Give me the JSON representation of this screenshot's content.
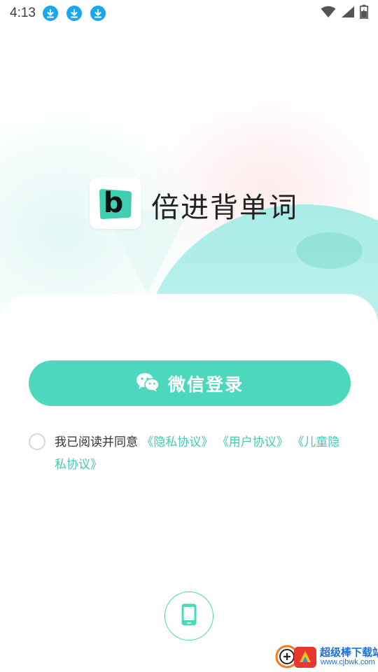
{
  "status_bar": {
    "time": "4:13",
    "notification_icons": [
      "download-icon",
      "download-icon",
      "download-icon"
    ],
    "right_icons": [
      "wifi-icon",
      "signal-icon",
      "battery-icon"
    ]
  },
  "app": {
    "logo_letter": "b",
    "name": "倍进背单词"
  },
  "login": {
    "wechat_button_label": "微信登录",
    "agreement_prefix": "我已阅读并同意",
    "privacy_link": "《隐私协议》",
    "user_link": "《用户协议》",
    "child_privacy_link": "《儿童隐私协议》"
  },
  "alt_login": {
    "phone_icon": "phone-icon"
  },
  "watermark": {
    "line1": "超级棒下载站",
    "line2": "www.cjbwk.com"
  },
  "colors": {
    "accent": "#4cd8bd",
    "link": "#41cbb3",
    "logo_green": "#3fcfb0",
    "download_blue": "#1aa7ee"
  }
}
